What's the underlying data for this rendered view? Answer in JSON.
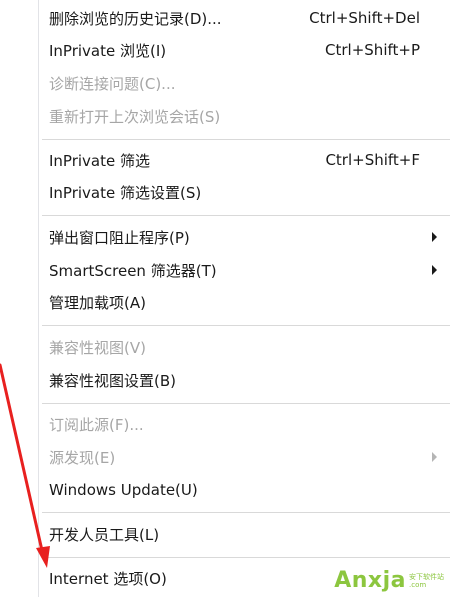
{
  "menu": {
    "items": [
      {
        "label": "删除浏览的历史记录(D)...",
        "shortcut": "Ctrl+Shift+Del"
      },
      {
        "label": "InPrivate 浏览(I)",
        "shortcut": "Ctrl+Shift+P"
      },
      {
        "label": "诊断连接问题(C)...",
        "shortcut": ""
      },
      {
        "label": "重新打开上次浏览会话(S)",
        "shortcut": ""
      },
      {
        "label": "InPrivate 筛选",
        "shortcut": "Ctrl+Shift+F"
      },
      {
        "label": "InPrivate 筛选设置(S)",
        "shortcut": ""
      },
      {
        "label": "弹出窗口阻止程序(P)",
        "shortcut": ""
      },
      {
        "label": "SmartScreen 筛选器(T)",
        "shortcut": ""
      },
      {
        "label": "管理加载项(A)",
        "shortcut": ""
      },
      {
        "label": "兼容性视图(V)",
        "shortcut": ""
      },
      {
        "label": "兼容性视图设置(B)",
        "shortcut": ""
      },
      {
        "label": "订阅此源(F)...",
        "shortcut": ""
      },
      {
        "label": "源发现(E)",
        "shortcut": ""
      },
      {
        "label": "Windows Update(U)",
        "shortcut": ""
      },
      {
        "label": "开发人员工具(L)",
        "shortcut": ""
      },
      {
        "label": "Internet 选项(O)",
        "shortcut": ""
      }
    ]
  },
  "watermark": {
    "logo": "Anxja",
    "sub_top": "安下软件站",
    "sub_bottom": ".com"
  },
  "annotation": {
    "arrow_color": "#e8201f"
  }
}
